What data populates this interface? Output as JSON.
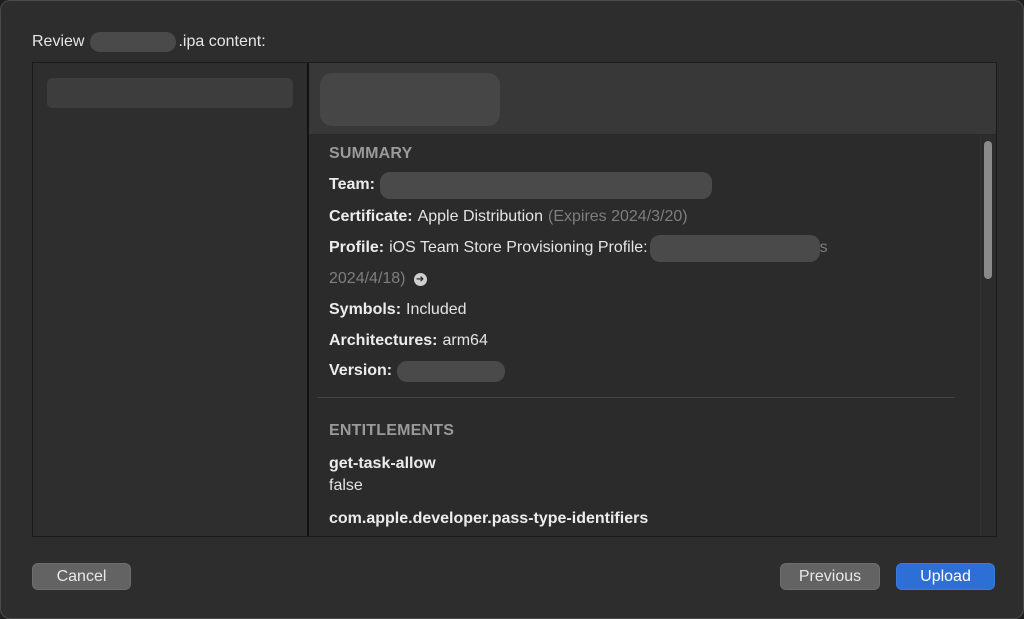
{
  "dialog": {
    "title_prefix": "Review",
    "title_suffix": ".ipa content:"
  },
  "summary": {
    "heading": "SUMMARY",
    "team_label": "Team:",
    "certificate_label": "Certificate:",
    "certificate_value": "Apple Distribution",
    "certificate_expiry": "(Expires 2024/3/20)",
    "profile_label": "Profile:",
    "profile_value": "iOS Team Store Provisioning Profile:",
    "profile_tail": "s",
    "profile_expiry": "2024/4/18)",
    "profile_link_icon": "arrow-circle-right-icon",
    "symbols_label": "Symbols:",
    "symbols_value": "Included",
    "architectures_label": "Architectures:",
    "architectures_value": "arm64",
    "version_label": "Version:"
  },
  "entitlements": {
    "heading": "ENTITLEMENTS",
    "items": [
      {
        "key": "get-task-allow",
        "value": "false"
      },
      {
        "key": "com.apple.developer.pass-type-identifiers",
        "value": ""
      }
    ]
  },
  "buttons": {
    "cancel": "Cancel",
    "previous": "Previous",
    "upload": "Upload"
  },
  "colors": {
    "accent": "#2e6fd6",
    "muted_text": "#7e7e7e",
    "section_heading": "#9a9a9a"
  }
}
